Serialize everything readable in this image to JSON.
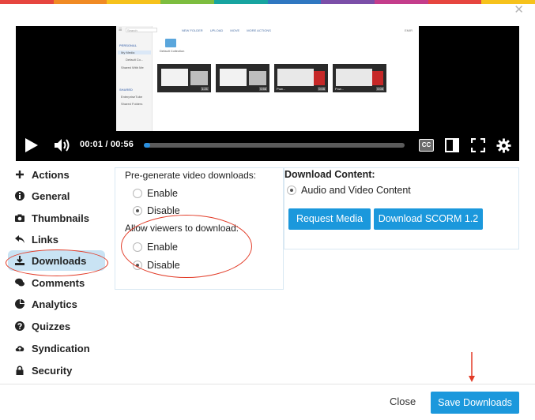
{
  "colors": {
    "accent": "#1b98dc",
    "highlight": "#c9e3f4",
    "annotation": "#e23b27",
    "rainbow": [
      "#e6453f",
      "#f08a24",
      "#f6c21c",
      "#7dbd3f",
      "#17a4a0",
      "#2f77c1",
      "#7b4fa8",
      "#c43d8b",
      "#e6453f",
      "#f6c21c"
    ]
  },
  "player": {
    "time": "00:01 / 00:56",
    "progress_fraction": 0.025,
    "cc_label": "CC",
    "preview": {
      "search_placeholder": "Search",
      "sections": [
        {
          "heading": "PERSONAL",
          "items": [
            "My Media",
            "Default Co...",
            "Shared With Me"
          ]
        },
        {
          "heading": "SHARED",
          "items": [
            "EnterpriseTube",
            "Shared Folders"
          ]
        }
      ],
      "toolbar": [
        "NEW FOLDER",
        "UPLOAD",
        "MOVE",
        "MORE ACTIONS"
      ],
      "user": "EMIR",
      "folder_label": "Default Collection",
      "thumbnails": [
        {
          "caption": "",
          "duration": "1:21"
        },
        {
          "caption": "",
          "duration": "0:56"
        },
        {
          "caption": "Pow...",
          "duration": "0:05"
        },
        {
          "caption": "Pow...",
          "duration": "0:05"
        }
      ]
    }
  },
  "sidebar": {
    "items": [
      {
        "label": "Actions",
        "icon": "plus-icon"
      },
      {
        "label": "General",
        "icon": "info-icon"
      },
      {
        "label": "Thumbnails",
        "icon": "camera-icon"
      },
      {
        "label": "Links",
        "icon": "share-arrow-icon"
      },
      {
        "label": "Downloads",
        "icon": "download-icon",
        "active": true
      },
      {
        "label": "Comments",
        "icon": "comments-icon"
      },
      {
        "label": "Analytics",
        "icon": "pie-chart-icon"
      },
      {
        "label": "Quizzes",
        "icon": "question-icon"
      },
      {
        "label": "Syndication",
        "icon": "cloud-upload-icon"
      },
      {
        "label": "Security",
        "icon": "lock-icon"
      }
    ]
  },
  "downloads": {
    "pregenerate": {
      "label": "Pre-generate video downloads:",
      "options": [
        {
          "label": "Enable",
          "checked": false
        },
        {
          "label": "Disable",
          "checked": true
        }
      ]
    },
    "allow_viewers": {
      "label": "Allow viewers to download:",
      "options": [
        {
          "label": "Enable",
          "checked": false
        },
        {
          "label": "Disable",
          "checked": true
        }
      ]
    },
    "content": {
      "label": "Download Content:",
      "option": "Audio and Video Content",
      "request_button": "Request Media",
      "scorm_button": "Download SCORM 1.2"
    }
  },
  "footer": {
    "close_label": "Close",
    "save_label": "Save Downloads"
  }
}
